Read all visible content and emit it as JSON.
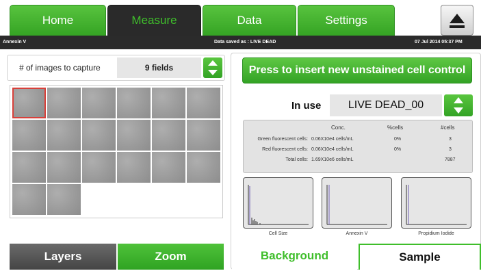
{
  "nav": {
    "tabs": [
      {
        "label": "Home",
        "active": false
      },
      {
        "label": "Measure",
        "active": true
      },
      {
        "label": "Data",
        "active": false
      },
      {
        "label": "Settings",
        "active": false
      }
    ],
    "eject_icon": "eject-icon"
  },
  "status": {
    "protocol": "Annexin V",
    "saved": "Data saved as : LIVE DEAD",
    "datetime": "07 Jul 2014  05:37 PM"
  },
  "capture": {
    "label": "# of images to capture",
    "value": "9 fields"
  },
  "image_grid": {
    "count": 20,
    "selected_index": 0
  },
  "left_buttons": {
    "layers": "Layers",
    "zoom": "Zoom"
  },
  "control": {
    "insert_label": "Press to insert new unstained cell control",
    "in_use_label": "In use",
    "in_use_value": "LIVE DEAD_00"
  },
  "results": {
    "headers": {
      "conc": "Conc.",
      "pct": "%cells",
      "num": "#cells"
    },
    "rows": [
      {
        "label": "Green fluorescent cells:",
        "conc": "0.06X10e4 cells/mL",
        "pct": "0%",
        "num": "3"
      },
      {
        "label": "Red fluorescent cells:",
        "conc": "0.06X10e4 cells/mL",
        "pct": "0%",
        "num": "3"
      },
      {
        "label": "Total cells:",
        "conc": "1.69X10e6 cells/mL",
        "pct": "",
        "num": "7887"
      }
    ]
  },
  "histograms": [
    {
      "label": "Cell Size"
    },
    {
      "label": "Annexin V"
    },
    {
      "label": "Propidium Iodide"
    }
  ],
  "bottom_tabs": {
    "background": "Background",
    "sample": "Sample"
  },
  "colors": {
    "accent_green": "#3fbe2b",
    "dark_bar": "#2b2b2b",
    "selected_border": "#d8403a"
  }
}
